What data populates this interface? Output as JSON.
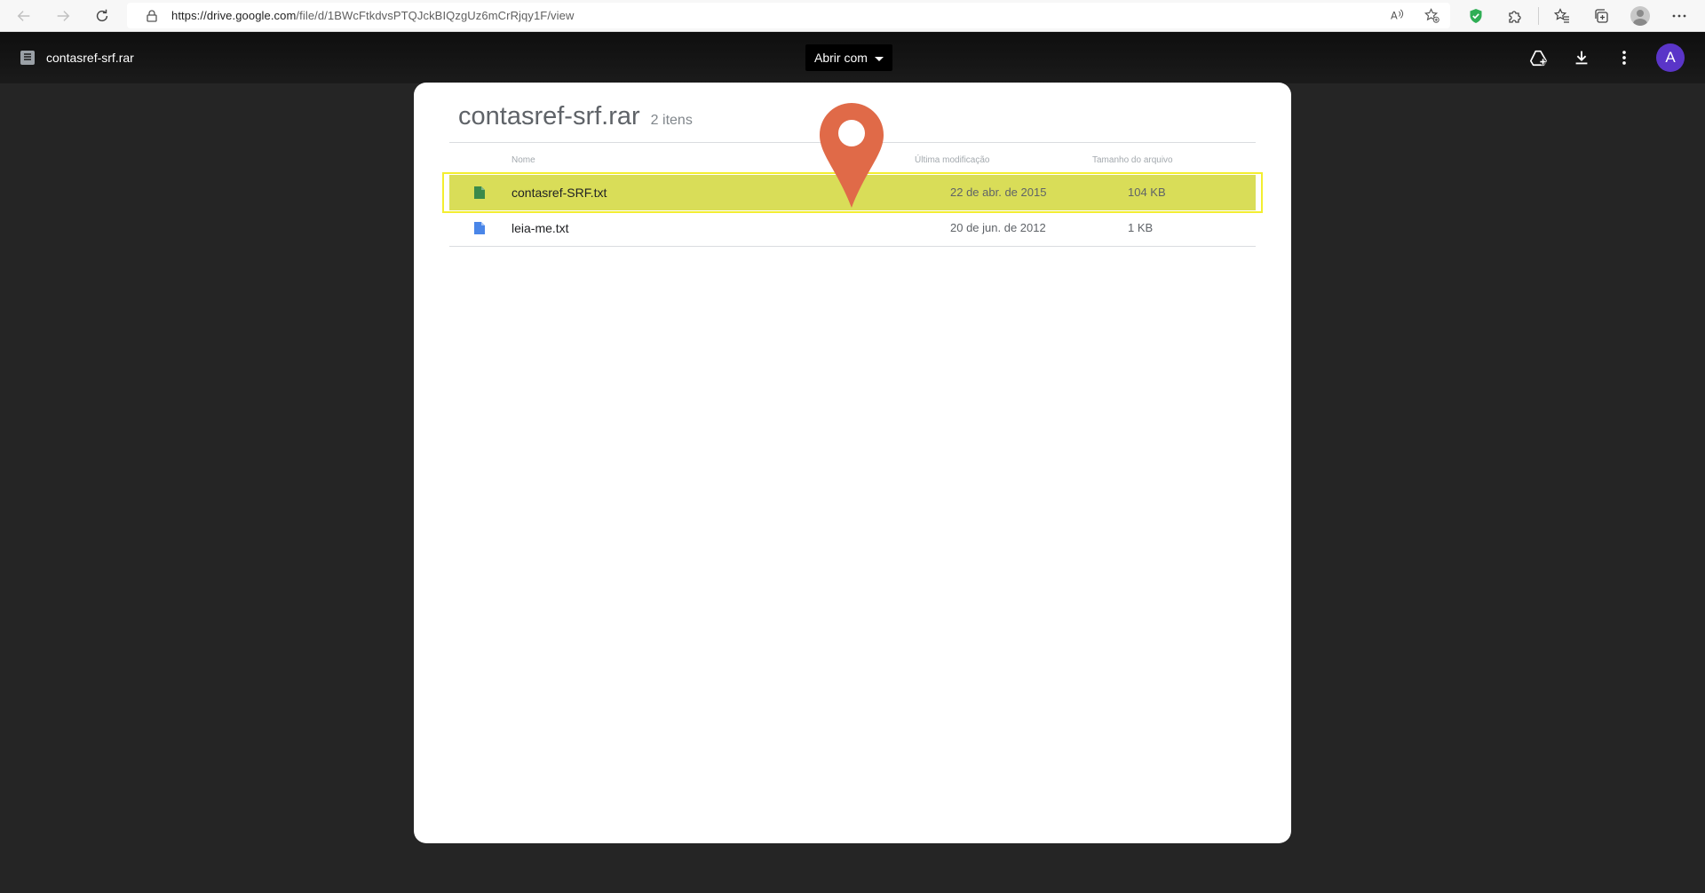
{
  "browser": {
    "url_host": "https://drive.google.com",
    "url_path": "/file/d/1BWcFtkdvsPTQJckBIQzgUz6mCrRjqy1F/view",
    "icons": [
      "back-icon",
      "forward-icon",
      "refresh-icon",
      "lock-icon",
      "read-aloud-icon",
      "favorite-add-icon",
      "shield-extension-icon",
      "extensions-icon",
      "favorites-icon",
      "collections-icon",
      "profile-icon",
      "more-icon"
    ]
  },
  "viewer": {
    "file_title": "contasref-srf.rar",
    "open_with_label": "Abrir com",
    "avatar_letter": "A",
    "avatar_color": "#5a35c8",
    "action_icons": [
      "add-to-drive-icon",
      "download-icon",
      "more-vert-icon"
    ]
  },
  "archive": {
    "name": "contasref-srf.rar",
    "count": "2 itens",
    "columns": {
      "name": "Nome",
      "modified": "Última modificação",
      "size": "Tamanho do arquivo"
    },
    "files": [
      {
        "name": "contasref-SRF.txt",
        "modified": "22 de abr. de 2015",
        "size": "104 KB",
        "icon": "file-icon",
        "icon_color": "#3b8a4a",
        "highlighted": true
      },
      {
        "name": "leia-me.txt",
        "modified": "20 de jun. de 2012",
        "size": "1 KB",
        "icon": "file-icon",
        "icon_color": "#4a86e8",
        "highlighted": false
      }
    ]
  },
  "annotation": {
    "marker": "map-pin-icon",
    "pin_color": "#e06a48",
    "highlight_color": "#d9dd58",
    "highlight_border_color": "#f3ee30"
  }
}
